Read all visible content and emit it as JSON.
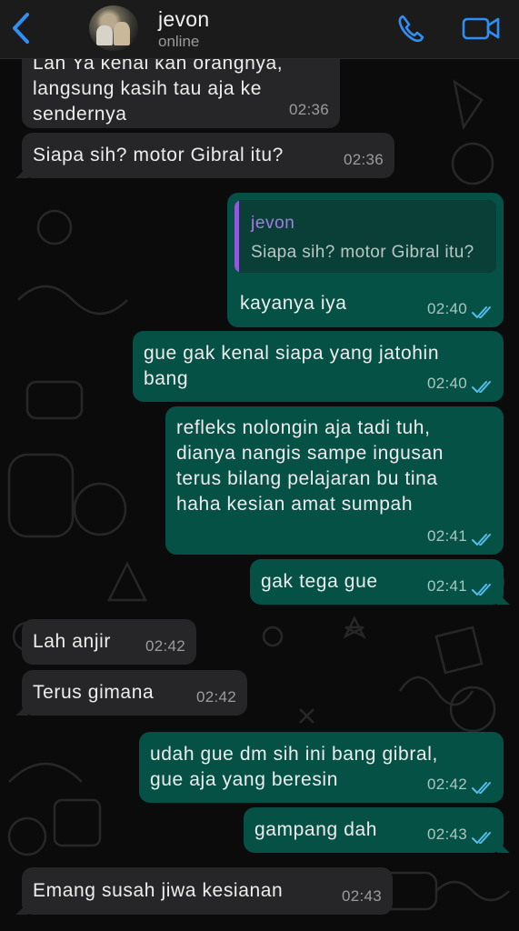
{
  "header": {
    "back_icon": "chevron-left-icon",
    "contact_name": "jevon",
    "status": "online",
    "call_icon": "phone-icon",
    "video_icon": "video-camera-icon",
    "accent_color": "#2f8ff5"
  },
  "colors": {
    "incoming_bubble": "#262628",
    "outgoing_bubble": "#055146",
    "read_tick": "#53bdeb",
    "quote_accent": "#8f5bd8"
  },
  "messages": [
    {
      "direction": "in",
      "text_lines": [
        "Lah Ya kenal kan orangnya,",
        "langsung kasih tau aja ke",
        "sendernya"
      ],
      "time": "02:36"
    },
    {
      "direction": "in",
      "text": "Siapa sih? motor Gibral itu?",
      "time": "02:36"
    },
    {
      "direction": "out",
      "quote": {
        "author": "jevon",
        "text": "Siapa sih? motor Gibral itu?"
      },
      "text": "kayanya iya",
      "time": "02:40",
      "status": "read"
    },
    {
      "direction": "out",
      "text_lines": [
        "gue gak kenal siapa yang jatohin",
        "bang"
      ],
      "time": "02:40",
      "status": "read"
    },
    {
      "direction": "out",
      "text_lines": [
        "refleks nolongin aja tadi tuh,",
        "dianya nangis sampe ingusan",
        "terus bilang pelajaran bu tina",
        "haha kesian amat sumpah"
      ],
      "time": "02:41",
      "status": "read"
    },
    {
      "direction": "out",
      "text": "gak tega gue",
      "time": "02:41",
      "status": "read"
    },
    {
      "direction": "in",
      "text": "Lah anjir",
      "time": "02:42"
    },
    {
      "direction": "in",
      "text": "Terus gimana",
      "time": "02:42"
    },
    {
      "direction": "out",
      "text_lines": [
        "udah gue dm sih ini bang gibral,",
        "gue aja yang beresin"
      ],
      "time": "02:42",
      "status": "read"
    },
    {
      "direction": "out",
      "text": "gampang dah",
      "time": "02:43",
      "status": "read"
    },
    {
      "direction": "in",
      "text": "Emang susah jiwa kesianan",
      "time": "02:43"
    }
  ]
}
